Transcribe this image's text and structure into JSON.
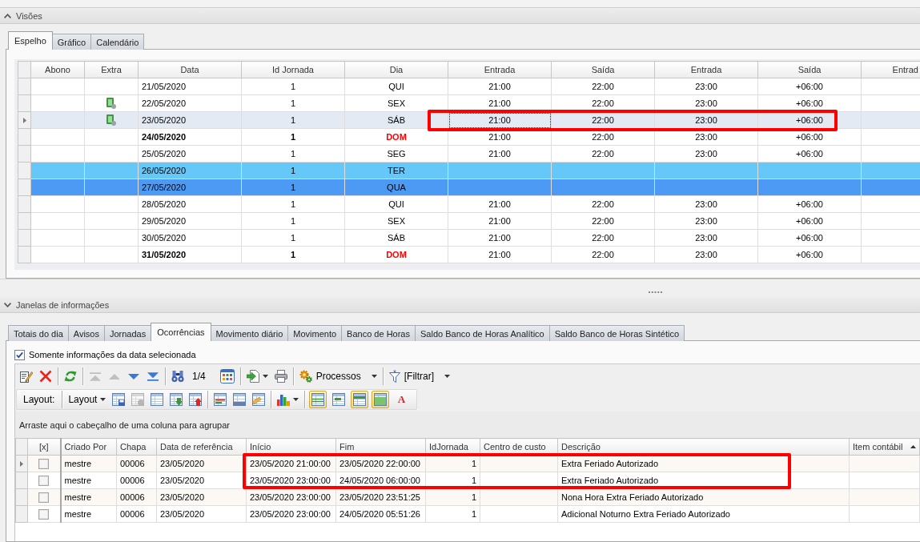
{
  "views": {
    "title": "Visões",
    "arrow_up": true,
    "tabs": [
      {
        "label": "Espelho",
        "selected": true
      },
      {
        "label": "Gráfico",
        "selected": false
      },
      {
        "label": "Calendário",
        "selected": false
      }
    ],
    "grid": {
      "highlight_frame": true,
      "columns": [
        {
          "label": "Abono",
          "kind": "abono",
          "focused": false
        },
        {
          "label": "Extra",
          "kind": "extra",
          "focused": false
        },
        {
          "label": "Data",
          "kind": "date",
          "focused": false
        },
        {
          "label": "Id Jornada",
          "kind": "journey",
          "focused": false
        },
        {
          "label": "Dia",
          "kind": "day",
          "focused": false
        },
        {
          "label": "Entrada",
          "kind": "time",
          "focused": true
        },
        {
          "label": "Saída",
          "kind": "time",
          "focused": false
        },
        {
          "label": "Entrada",
          "kind": "time",
          "focused": false
        },
        {
          "label": "Saída",
          "kind": "time",
          "focused": false
        },
        {
          "label": "Entrad",
          "kind": "time",
          "focused": false
        }
      ],
      "rows": [
        {
          "date": "21/05/2020",
          "journey": "1",
          "day": "QUI",
          "times": [
            "21:00",
            "22:00",
            "23:00",
            "+06:00"
          ],
          "extra": false,
          "kind": "weekday",
          "selected": false
        },
        {
          "date": "22/05/2020",
          "journey": "1",
          "day": "SEX",
          "times": [
            "21:00",
            "22:00",
            "23:00",
            "+06:00"
          ],
          "extra": true,
          "kind": "weekday",
          "selected": false
        },
        {
          "date": "23/05/2020",
          "journey": "1",
          "day": "SÁB",
          "times": [
            "21:00",
            "22:00",
            "23:00",
            "+06:00"
          ],
          "extra": true,
          "kind": "weekday",
          "selected": true
        },
        {
          "date": "24/05/2020",
          "journey": "1",
          "day": "DOM",
          "times": [
            "21:00",
            "22:00",
            "23:00",
            "+06:00"
          ],
          "extra": false,
          "kind": "sunday",
          "selected": false
        },
        {
          "date": "25/05/2020",
          "journey": "1",
          "day": "SEG",
          "times": [
            "21:00",
            "22:00",
            "23:00",
            "+06:00"
          ],
          "extra": false,
          "kind": "weekday",
          "selected": false
        },
        {
          "date": "26/05/2020",
          "journey": "1",
          "day": "TER",
          "extra": false,
          "kind": "weekday",
          "selected": false,
          "color": "#66c8f8"
        },
        {
          "date": "27/05/2020",
          "journey": "1",
          "day": "QUA",
          "extra": false,
          "kind": "weekday",
          "selected": false,
          "color": "#4c9af4"
        },
        {
          "date": "28/05/2020",
          "journey": "1",
          "day": "QUI",
          "times": [
            "21:00",
            "22:00",
            "23:00",
            "+06:00"
          ],
          "extra": false,
          "kind": "weekday",
          "selected": false
        },
        {
          "date": "29/05/2020",
          "journey": "1",
          "day": "SEX",
          "times": [
            "21:00",
            "22:00",
            "23:00",
            "+06:00"
          ],
          "extra": false,
          "kind": "weekday",
          "selected": false
        },
        {
          "date": "30/05/2020",
          "journey": "1",
          "day": "SÁB",
          "times": [
            "21:00",
            "22:00",
            "23:00",
            "+06:00"
          ],
          "extra": false,
          "kind": "weekday",
          "selected": false
        },
        {
          "date": "31/05/2020",
          "journey": "1",
          "day": "DOM",
          "times": [
            "21:00",
            "22:00",
            "23:00",
            "+06:00"
          ],
          "extra": false,
          "kind": "sunday",
          "selected": false
        }
      ]
    }
  },
  "info": {
    "title": "Janelas de informações",
    "arrow_up": false,
    "tabs": [
      {
        "label": "Totais do dia",
        "selected": false
      },
      {
        "label": "Avisos",
        "selected": false
      },
      {
        "label": "Jornadas",
        "selected": false
      },
      {
        "label": "Ocorrências",
        "selected": true
      },
      {
        "label": "Movimento diário",
        "selected": false
      },
      {
        "label": "Movimento",
        "selected": false
      },
      {
        "label": "Banco de Horas",
        "selected": false
      },
      {
        "label": "Saldo Banco de Horas Analítico",
        "selected": false
      },
      {
        "label": "Saldo Banco de Horas Sintético",
        "selected": false
      }
    ],
    "filter_checkbox": {
      "label": "Somente informações da data selecionada",
      "checked": true
    },
    "toolbar": [
      {
        "kind": "edit",
        "disabled": false
      },
      {
        "kind": "delete",
        "disabled": false
      },
      {
        "kind": "separator"
      },
      {
        "kind": "refresh",
        "disabled": false
      },
      {
        "kind": "separator"
      },
      {
        "kind": "first",
        "disabled": true
      },
      {
        "kind": "previous",
        "disabled": true
      },
      {
        "kind": "next",
        "disabled": false
      },
      {
        "kind": "last",
        "disabled": false
      },
      {
        "kind": "separator"
      },
      {
        "kind": "find",
        "disabled": false
      },
      {
        "kind": "counter",
        "label": "1/4"
      },
      {
        "kind": "calendar",
        "disabled": false
      },
      {
        "kind": "separator"
      },
      {
        "kind": "export",
        "disabled": false,
        "dropdown": true
      },
      {
        "kind": "print",
        "disabled": false
      },
      {
        "kind": "separator"
      },
      {
        "kind": "processes",
        "label": "Processos",
        "disabled": false,
        "dropdown": true
      },
      {
        "kind": "separator"
      },
      {
        "kind": "filter",
        "label": "[Filtrar]",
        "disabled": false,
        "dropdown": true
      }
    ],
    "layout_toolbar": [
      {
        "kind": "label",
        "label": "Layout:"
      },
      {
        "kind": "separator"
      },
      {
        "kind": "layout_menu",
        "label": "Layout",
        "disabled": false,
        "dropdown": true
      },
      {
        "kind": "save_layout",
        "disabled": false
      },
      {
        "kind": "delete_layout",
        "disabled": true
      },
      {
        "kind": "table",
        "disabled": false
      },
      {
        "kind": "import",
        "disabled": false
      },
      {
        "kind": "export_layout",
        "disabled": false
      },
      {
        "kind": "separator"
      },
      {
        "kind": "columns",
        "disabled": false
      },
      {
        "kind": "totals",
        "disabled": false
      },
      {
        "kind": "edit_layout",
        "disabled": false
      },
      {
        "kind": "separator"
      },
      {
        "kind": "chart",
        "disabled": false,
        "dropdown": true
      },
      {
        "kind": "separator"
      }
    ],
    "view_toggles": [
      {
        "kind": "grid_lines",
        "selected": true
      },
      {
        "kind": "group_panel",
        "selected": false
      },
      {
        "kind": "header",
        "selected": true
      },
      {
        "kind": "footer",
        "selected": true
      },
      {
        "kind": "font",
        "label": "A",
        "selected": false
      }
    ],
    "group_hint": "Arraste aqui o cabeçalho de uma coluna para agrupar",
    "grid": {
      "highlight_frame": true,
      "columns": [
        {
          "label": "[x]",
          "kind": "check",
          "sorted": false
        },
        {
          "label": "Criado Por",
          "kind": "text",
          "sorted": false
        },
        {
          "label": "Chapa",
          "kind": "text",
          "sorted": false
        },
        {
          "label": "Data de referência",
          "kind": "text",
          "sorted": false
        },
        {
          "label": "Início",
          "kind": "text",
          "sorted": false
        },
        {
          "label": "Fim",
          "kind": "text",
          "sorted": false
        },
        {
          "label": "IdJornada",
          "kind": "number",
          "sorted": false
        },
        {
          "label": "Centro de custo",
          "kind": "text",
          "sorted": false
        },
        {
          "label": "Descrição",
          "kind": "text",
          "sorted": false
        },
        {
          "label": "Item contábil",
          "kind": "text",
          "sorted": true
        }
      ],
      "rows": [
        {
          "checked": false,
          "selected": true,
          "cells": [
            "",
            "mestre",
            "00006",
            "23/05/2020",
            "23/05/2020 21:00:00",
            "23/05/2020 22:00:00",
            "1",
            "",
            "Extra Feriado Autorizado"
          ]
        },
        {
          "checked": false,
          "selected": false,
          "cells": [
            "",
            "mestre",
            "00006",
            "23/05/2020",
            "23/05/2020 23:00:00",
            "24/05/2020 06:00:00",
            "1",
            "",
            "Extra Feriado Autorizado"
          ]
        },
        {
          "checked": false,
          "selected": false,
          "cells": [
            "",
            "mestre",
            "00006",
            "23/05/2020",
            "23/05/2020 23:00:00",
            "23/05/2020 23:51:25",
            "1",
            "",
            "Nona Hora Extra Feriado Autorizado"
          ]
        },
        {
          "checked": false,
          "selected": false,
          "cells": [
            "",
            "mestre",
            "00006",
            "23/05/2020",
            "23/05/2020 23:00:00",
            "24/05/2020 05:51:26",
            "1",
            "",
            "Adicional Noturno Extra Feriado Autorizado"
          ]
        }
      ]
    }
  }
}
